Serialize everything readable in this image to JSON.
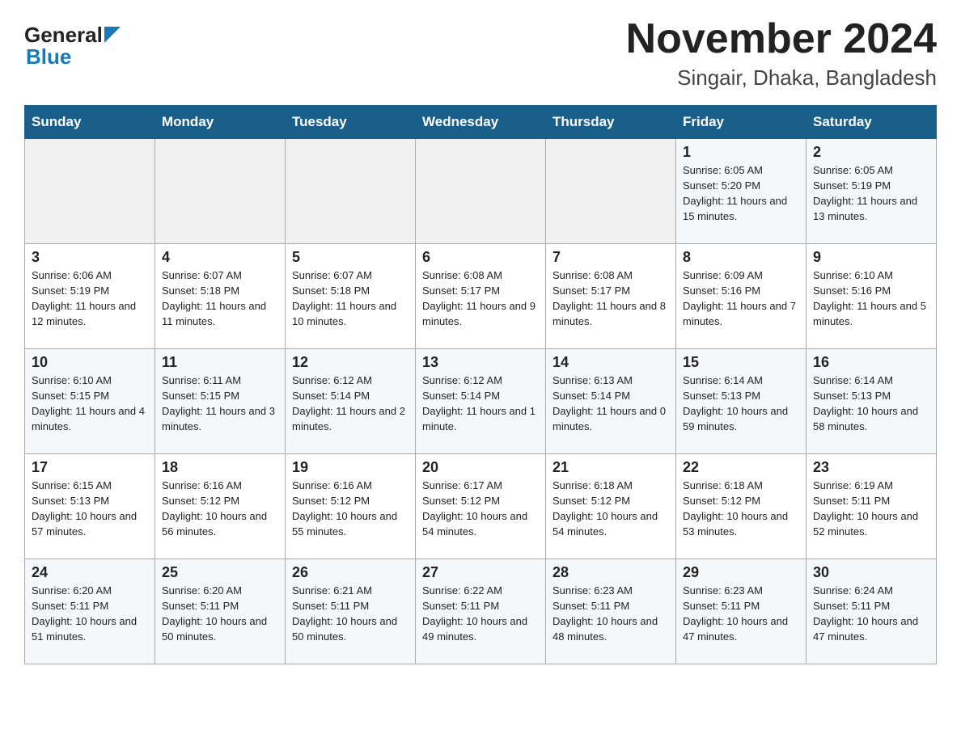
{
  "header": {
    "logo_general": "General",
    "logo_blue": "Blue",
    "month_year": "November 2024",
    "location": "Singair, Dhaka, Bangladesh"
  },
  "days_of_week": [
    "Sunday",
    "Monday",
    "Tuesday",
    "Wednesday",
    "Thursday",
    "Friday",
    "Saturday"
  ],
  "weeks": [
    {
      "days": [
        {
          "number": "",
          "info": ""
        },
        {
          "number": "",
          "info": ""
        },
        {
          "number": "",
          "info": ""
        },
        {
          "number": "",
          "info": ""
        },
        {
          "number": "",
          "info": ""
        },
        {
          "number": "1",
          "info": "Sunrise: 6:05 AM\nSunset: 5:20 PM\nDaylight: 11 hours and 15 minutes."
        },
        {
          "number": "2",
          "info": "Sunrise: 6:05 AM\nSunset: 5:19 PM\nDaylight: 11 hours and 13 minutes."
        }
      ]
    },
    {
      "days": [
        {
          "number": "3",
          "info": "Sunrise: 6:06 AM\nSunset: 5:19 PM\nDaylight: 11 hours and 12 minutes."
        },
        {
          "number": "4",
          "info": "Sunrise: 6:07 AM\nSunset: 5:18 PM\nDaylight: 11 hours and 11 minutes."
        },
        {
          "number": "5",
          "info": "Sunrise: 6:07 AM\nSunset: 5:18 PM\nDaylight: 11 hours and 10 minutes."
        },
        {
          "number": "6",
          "info": "Sunrise: 6:08 AM\nSunset: 5:17 PM\nDaylight: 11 hours and 9 minutes."
        },
        {
          "number": "7",
          "info": "Sunrise: 6:08 AM\nSunset: 5:17 PM\nDaylight: 11 hours and 8 minutes."
        },
        {
          "number": "8",
          "info": "Sunrise: 6:09 AM\nSunset: 5:16 PM\nDaylight: 11 hours and 7 minutes."
        },
        {
          "number": "9",
          "info": "Sunrise: 6:10 AM\nSunset: 5:16 PM\nDaylight: 11 hours and 5 minutes."
        }
      ]
    },
    {
      "days": [
        {
          "number": "10",
          "info": "Sunrise: 6:10 AM\nSunset: 5:15 PM\nDaylight: 11 hours and 4 minutes."
        },
        {
          "number": "11",
          "info": "Sunrise: 6:11 AM\nSunset: 5:15 PM\nDaylight: 11 hours and 3 minutes."
        },
        {
          "number": "12",
          "info": "Sunrise: 6:12 AM\nSunset: 5:14 PM\nDaylight: 11 hours and 2 minutes."
        },
        {
          "number": "13",
          "info": "Sunrise: 6:12 AM\nSunset: 5:14 PM\nDaylight: 11 hours and 1 minute."
        },
        {
          "number": "14",
          "info": "Sunrise: 6:13 AM\nSunset: 5:14 PM\nDaylight: 11 hours and 0 minutes."
        },
        {
          "number": "15",
          "info": "Sunrise: 6:14 AM\nSunset: 5:13 PM\nDaylight: 10 hours and 59 minutes."
        },
        {
          "number": "16",
          "info": "Sunrise: 6:14 AM\nSunset: 5:13 PM\nDaylight: 10 hours and 58 minutes."
        }
      ]
    },
    {
      "days": [
        {
          "number": "17",
          "info": "Sunrise: 6:15 AM\nSunset: 5:13 PM\nDaylight: 10 hours and 57 minutes."
        },
        {
          "number": "18",
          "info": "Sunrise: 6:16 AM\nSunset: 5:12 PM\nDaylight: 10 hours and 56 minutes."
        },
        {
          "number": "19",
          "info": "Sunrise: 6:16 AM\nSunset: 5:12 PM\nDaylight: 10 hours and 55 minutes."
        },
        {
          "number": "20",
          "info": "Sunrise: 6:17 AM\nSunset: 5:12 PM\nDaylight: 10 hours and 54 minutes."
        },
        {
          "number": "21",
          "info": "Sunrise: 6:18 AM\nSunset: 5:12 PM\nDaylight: 10 hours and 54 minutes."
        },
        {
          "number": "22",
          "info": "Sunrise: 6:18 AM\nSunset: 5:12 PM\nDaylight: 10 hours and 53 minutes."
        },
        {
          "number": "23",
          "info": "Sunrise: 6:19 AM\nSunset: 5:11 PM\nDaylight: 10 hours and 52 minutes."
        }
      ]
    },
    {
      "days": [
        {
          "number": "24",
          "info": "Sunrise: 6:20 AM\nSunset: 5:11 PM\nDaylight: 10 hours and 51 minutes."
        },
        {
          "number": "25",
          "info": "Sunrise: 6:20 AM\nSunset: 5:11 PM\nDaylight: 10 hours and 50 minutes."
        },
        {
          "number": "26",
          "info": "Sunrise: 6:21 AM\nSunset: 5:11 PM\nDaylight: 10 hours and 50 minutes."
        },
        {
          "number": "27",
          "info": "Sunrise: 6:22 AM\nSunset: 5:11 PM\nDaylight: 10 hours and 49 minutes."
        },
        {
          "number": "28",
          "info": "Sunrise: 6:23 AM\nSunset: 5:11 PM\nDaylight: 10 hours and 48 minutes."
        },
        {
          "number": "29",
          "info": "Sunrise: 6:23 AM\nSunset: 5:11 PM\nDaylight: 10 hours and 47 minutes."
        },
        {
          "number": "30",
          "info": "Sunrise: 6:24 AM\nSunset: 5:11 PM\nDaylight: 10 hours and 47 minutes."
        }
      ]
    }
  ]
}
